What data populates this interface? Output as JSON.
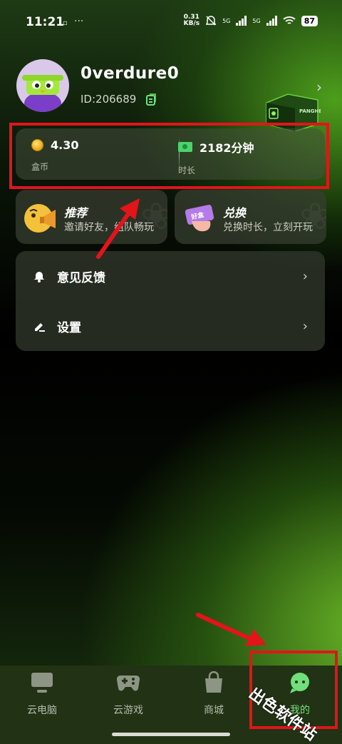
{
  "status_bar": {
    "time": "11:21",
    "speed_value": "0.31",
    "speed_unit": "KB/s",
    "net1": "5G",
    "net2": "5G",
    "battery": "87"
  },
  "profile": {
    "username": "0verdure0",
    "user_id": "ID:206689",
    "box_brand": "PANGHE Box"
  },
  "stats": {
    "coins_value": "4.30",
    "coins_label": "盒币",
    "time_value": "2182分钟",
    "time_label": "时长"
  },
  "promos": [
    {
      "title": "推荐",
      "subtitle": "邀请好友，组队畅玩"
    },
    {
      "title": "兑换",
      "subtitle": "兑换时长，立刻开玩",
      "ticket": "好盒"
    }
  ],
  "menu": [
    {
      "label": "意见反馈",
      "icon": "bell-icon"
    },
    {
      "label": "设置",
      "icon": "pencil-icon"
    }
  ],
  "nav": [
    {
      "label": "云电脑",
      "icon": "monitor-icon",
      "active": false
    },
    {
      "label": "云游戏",
      "icon": "gamepad-icon",
      "active": false
    },
    {
      "label": "商城",
      "icon": "shopping-bag-icon",
      "active": false
    },
    {
      "label": "我的",
      "icon": "profile-chat-icon",
      "active": true
    }
  ],
  "watermark": "出色软件站",
  "colors": {
    "highlight": "#e3141a",
    "accent_green": "#77e07f",
    "coin": "#e7a812"
  }
}
